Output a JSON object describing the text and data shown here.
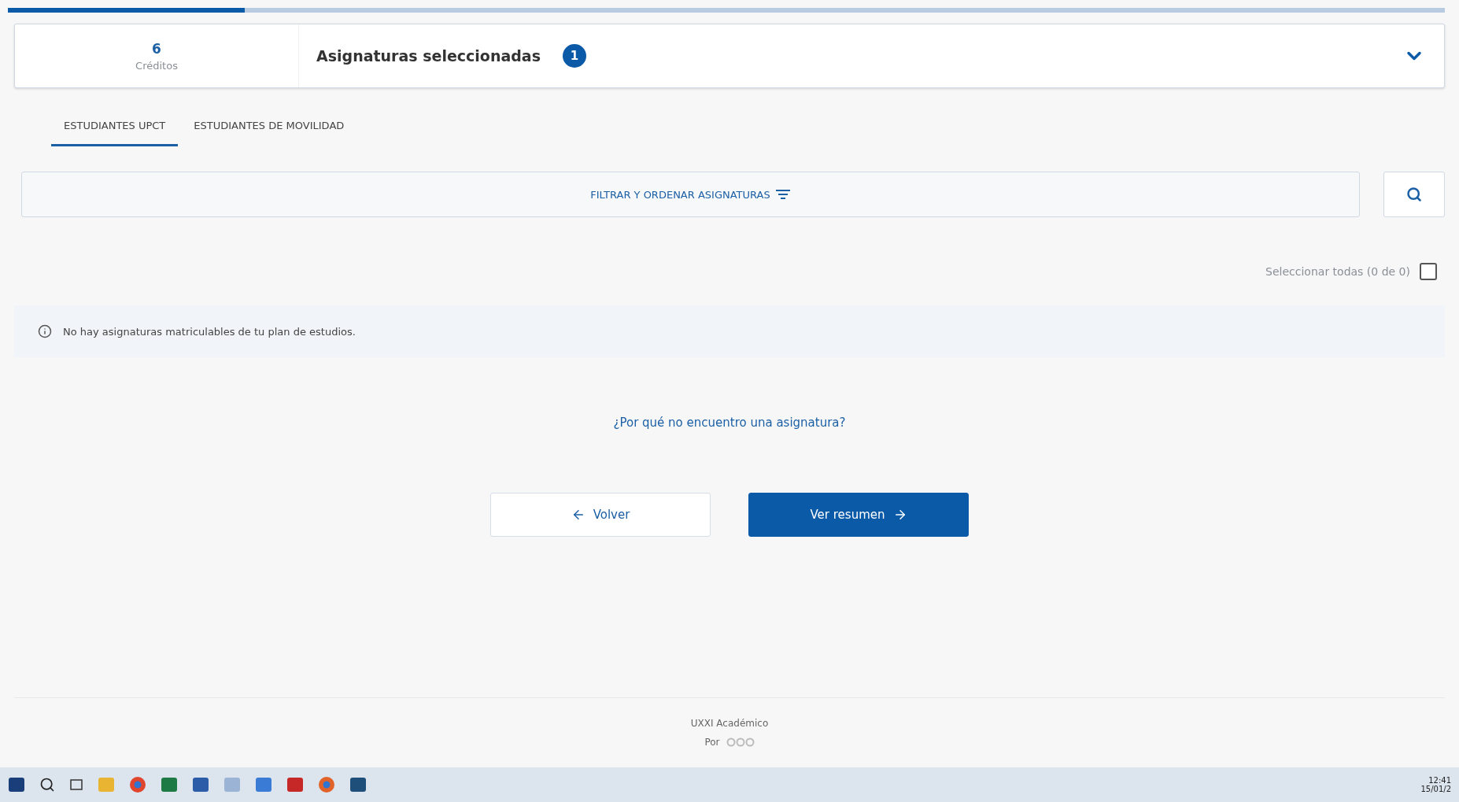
{
  "progress": {
    "level": 0.165
  },
  "summary": {
    "credits": "6",
    "credits_label": "Créditos",
    "title": "Asignaturas seleccionadas",
    "count": "1",
    "expanded": false
  },
  "tabs": [
    {
      "label": "ESTUDIANTES UPCT",
      "selected": true
    },
    {
      "label": "ESTUDIANTES DE MOVILIDAD",
      "selected": false
    }
  ],
  "filter": {
    "label": "FILTRAR Y ORDENAR ASIGNATURAS"
  },
  "select_all": {
    "label": "Seleccionar todas (0 de 0)",
    "checked": false
  },
  "notice": "No hay asignaturas matriculables de tu plan de estudios.",
  "help_link": "¿Por qué no encuentro una asignatura?",
  "buttons": [
    {
      "label": "Volver",
      "kind": "back"
    },
    {
      "label": "Ver resumen",
      "kind": "next"
    }
  ],
  "footer": {
    "product": "UXXI Académico",
    "by": "Por"
  },
  "taskbar": {
    "time": "12:41",
    "date": "15/01/2"
  }
}
